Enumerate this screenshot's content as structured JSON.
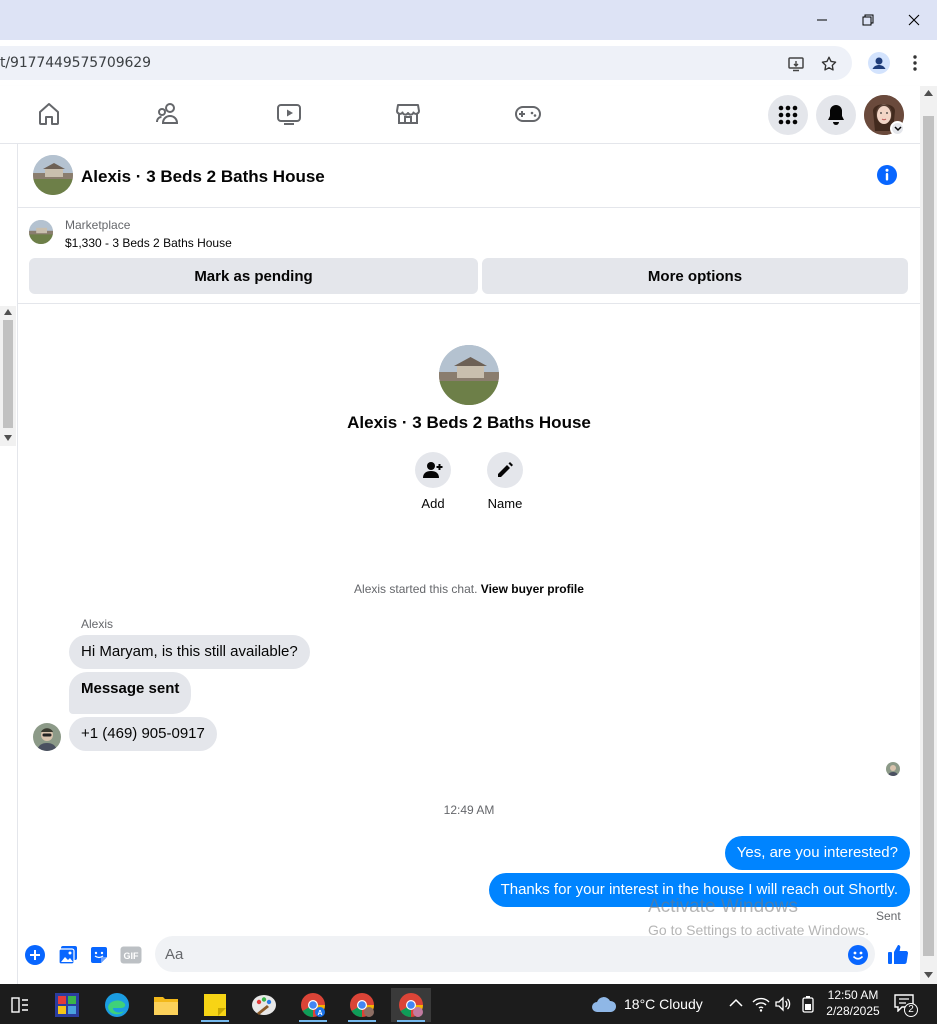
{
  "browser": {
    "url": "t/9177449575709629"
  },
  "chat": {
    "title": "Alexis · 3 Beds 2 Baths House",
    "marketplace_label": "Marketplace",
    "listing": "$1,330 - 3 Beds 2 Baths House",
    "mark_pending_label": "Mark as pending",
    "more_options_label": "More options",
    "profile_name": "Alexis · 3 Beds 2 Baths House",
    "add_label": "Add",
    "name_label": "Name",
    "system_note": "Alexis started this chat.",
    "view_profile_label": "View buyer profile",
    "sender_name": "Alexis",
    "messages_in": [
      "Hi Maryam, is this still available?",
      "Message sent",
      "+1 (469) 905-0917"
    ],
    "timestamp": "12:49 AM",
    "messages_out": [
      "Yes, are you interested?",
      "Thanks for your interest in the house I will reach out Shortly."
    ],
    "sent_status": "Sent",
    "input_placeholder": "Aa"
  },
  "watermark": {
    "line1": "Activate Windows",
    "line2": "Go to Settings to activate Windows."
  },
  "taskbar": {
    "weather": "18°C  Cloudy",
    "time": "12:50 AM",
    "date": "2/28/2025",
    "notifications": "2"
  },
  "colors": {
    "messenger_blue": "#0084ff",
    "fb_blue": "#0866ff",
    "bubble_gray": "#e4e6eb"
  }
}
